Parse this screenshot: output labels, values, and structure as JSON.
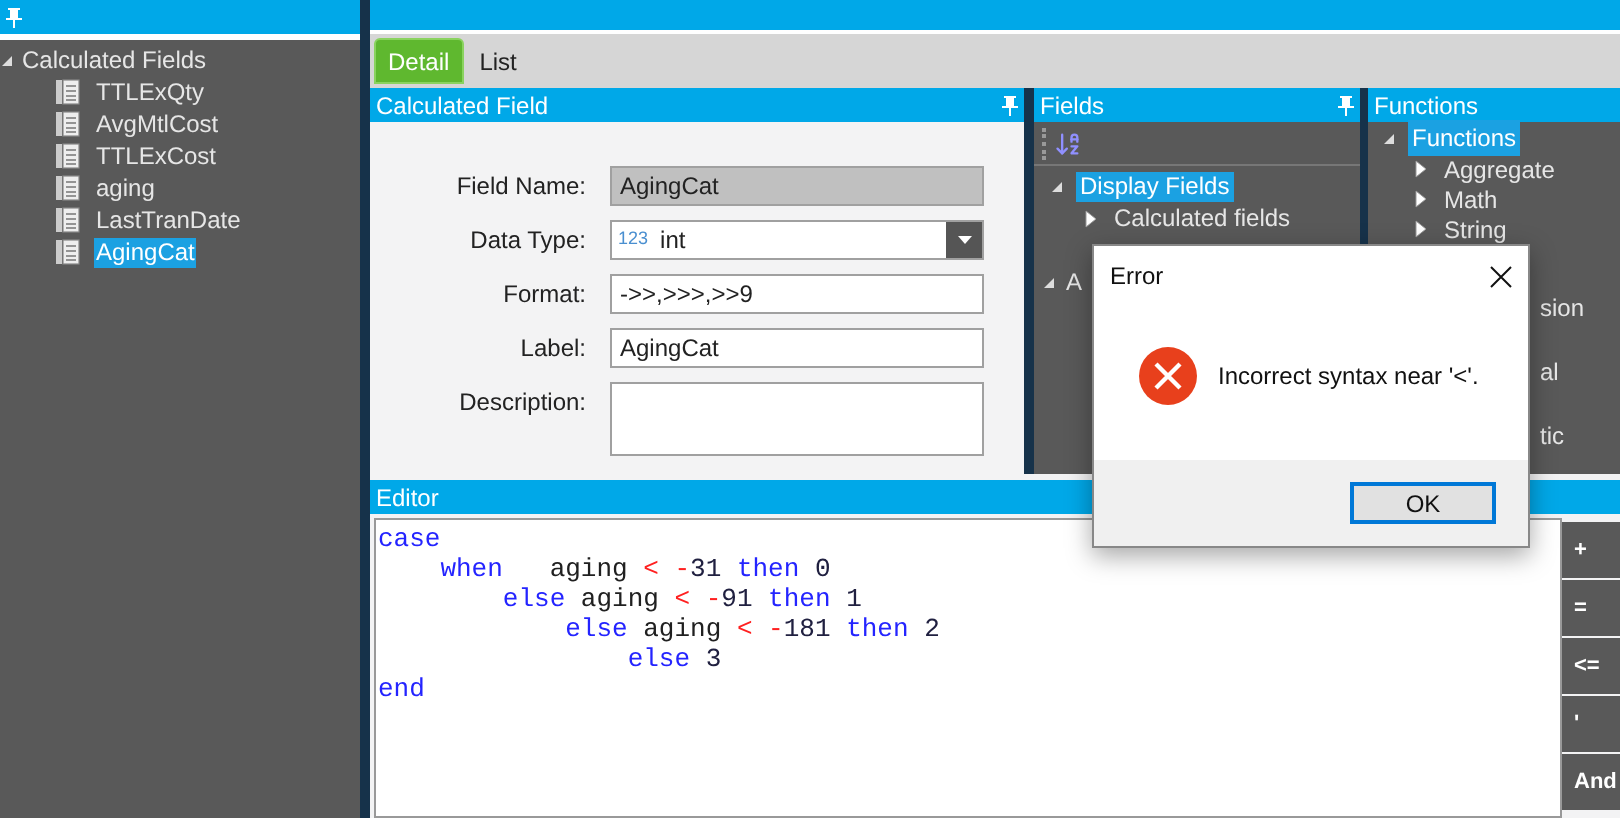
{
  "left_panel": {
    "tree": [
      {
        "label": "Calculated Fields",
        "expanded": true,
        "selected": false,
        "children": [
          {
            "label": "TTLExQty",
            "selected": false
          },
          {
            "label": "AvgMtlCost",
            "selected": false
          },
          {
            "label": "TTLExCost",
            "selected": false
          },
          {
            "label": "aging",
            "selected": false
          },
          {
            "label": "LastTranDate",
            "selected": false
          },
          {
            "label": "AgingCat",
            "selected": true
          }
        ]
      }
    ]
  },
  "tabs": [
    {
      "label": "Detail",
      "selected": true
    },
    {
      "label": "List",
      "selected": false
    }
  ],
  "calculated_field": {
    "title": "Calculated Field",
    "fields": [
      {
        "label": "Field Name:",
        "kind": "readonly",
        "value": "AgingCat"
      },
      {
        "label": "Data Type:",
        "kind": "select",
        "type_badge": "123",
        "value": "int"
      },
      {
        "label": "Format:",
        "kind": "text",
        "value": "->>,>>>,>>9"
      },
      {
        "label": "Label:",
        "kind": "text",
        "value": "AgingCat"
      },
      {
        "label": "Description:",
        "kind": "textarea"
      }
    ]
  },
  "fields_panel": {
    "title": "Fields",
    "tree": [
      {
        "label": "Display Fields",
        "selected": true,
        "expanded": true,
        "children": [
          {
            "label": "Calculated fields",
            "selected": false,
            "expanded": false
          }
        ]
      },
      {
        "label": "A",
        "selected": false,
        "expanded": true,
        "kind": "partial"
      }
    ]
  },
  "functions_panel": {
    "title": "Functions",
    "tree": [
      {
        "label": "Functions",
        "selected": true,
        "expanded": true,
        "children": [
          {
            "label": "Aggregate",
            "selected": false,
            "expanded": false
          },
          {
            "label": "Math",
            "selected": false,
            "expanded": false
          },
          {
            "label": "String",
            "selected": false,
            "expanded": false
          },
          {
            "label": "sion",
            "selected": false,
            "kind": "partial"
          },
          {
            "label": "al",
            "selected": false,
            "kind": "partial"
          },
          {
            "label": "tic",
            "selected": false,
            "kind": "partial"
          }
        ]
      }
    ]
  },
  "editor": {
    "title": "Editor",
    "code": [
      [
        {
          "text": "case",
          "kind": "keyword"
        }
      ],
      [
        {
          "text": "    when",
          "kind": "keyword"
        },
        {
          "text": "   aging ",
          "kind": "ident"
        },
        {
          "text": "< -",
          "kind": "operator"
        },
        {
          "text": "31 ",
          "kind": "number"
        },
        {
          "text": "then",
          "kind": "keyword"
        },
        {
          "text": " 0",
          "kind": "number"
        }
      ],
      [
        {
          "text": "        else",
          "kind": "keyword"
        },
        {
          "text": " aging ",
          "kind": "ident"
        },
        {
          "text": "< -",
          "kind": "operator"
        },
        {
          "text": "91 ",
          "kind": "number"
        },
        {
          "text": "then",
          "kind": "keyword"
        },
        {
          "text": " 1",
          "kind": "number"
        }
      ],
      [
        {
          "text": "            else",
          "kind": "keyword"
        },
        {
          "text": " aging ",
          "kind": "ident"
        },
        {
          "text": "< -",
          "kind": "operator"
        },
        {
          "text": "181 ",
          "kind": "number"
        },
        {
          "text": "then",
          "kind": "keyword"
        },
        {
          "text": " 2",
          "kind": "number"
        }
      ],
      [
        {
          "text": "                else",
          "kind": "keyword"
        },
        {
          "text": " 3",
          "kind": "number"
        }
      ],
      [
        {
          "text": "end",
          "kind": "keyword"
        }
      ]
    ],
    "buttons": [
      "+",
      "=",
      "<=",
      "'",
      "And"
    ]
  },
  "dialog": {
    "title": "Error",
    "message": "Incorrect syntax near '<'.",
    "buttons": [
      "OK"
    ]
  }
}
